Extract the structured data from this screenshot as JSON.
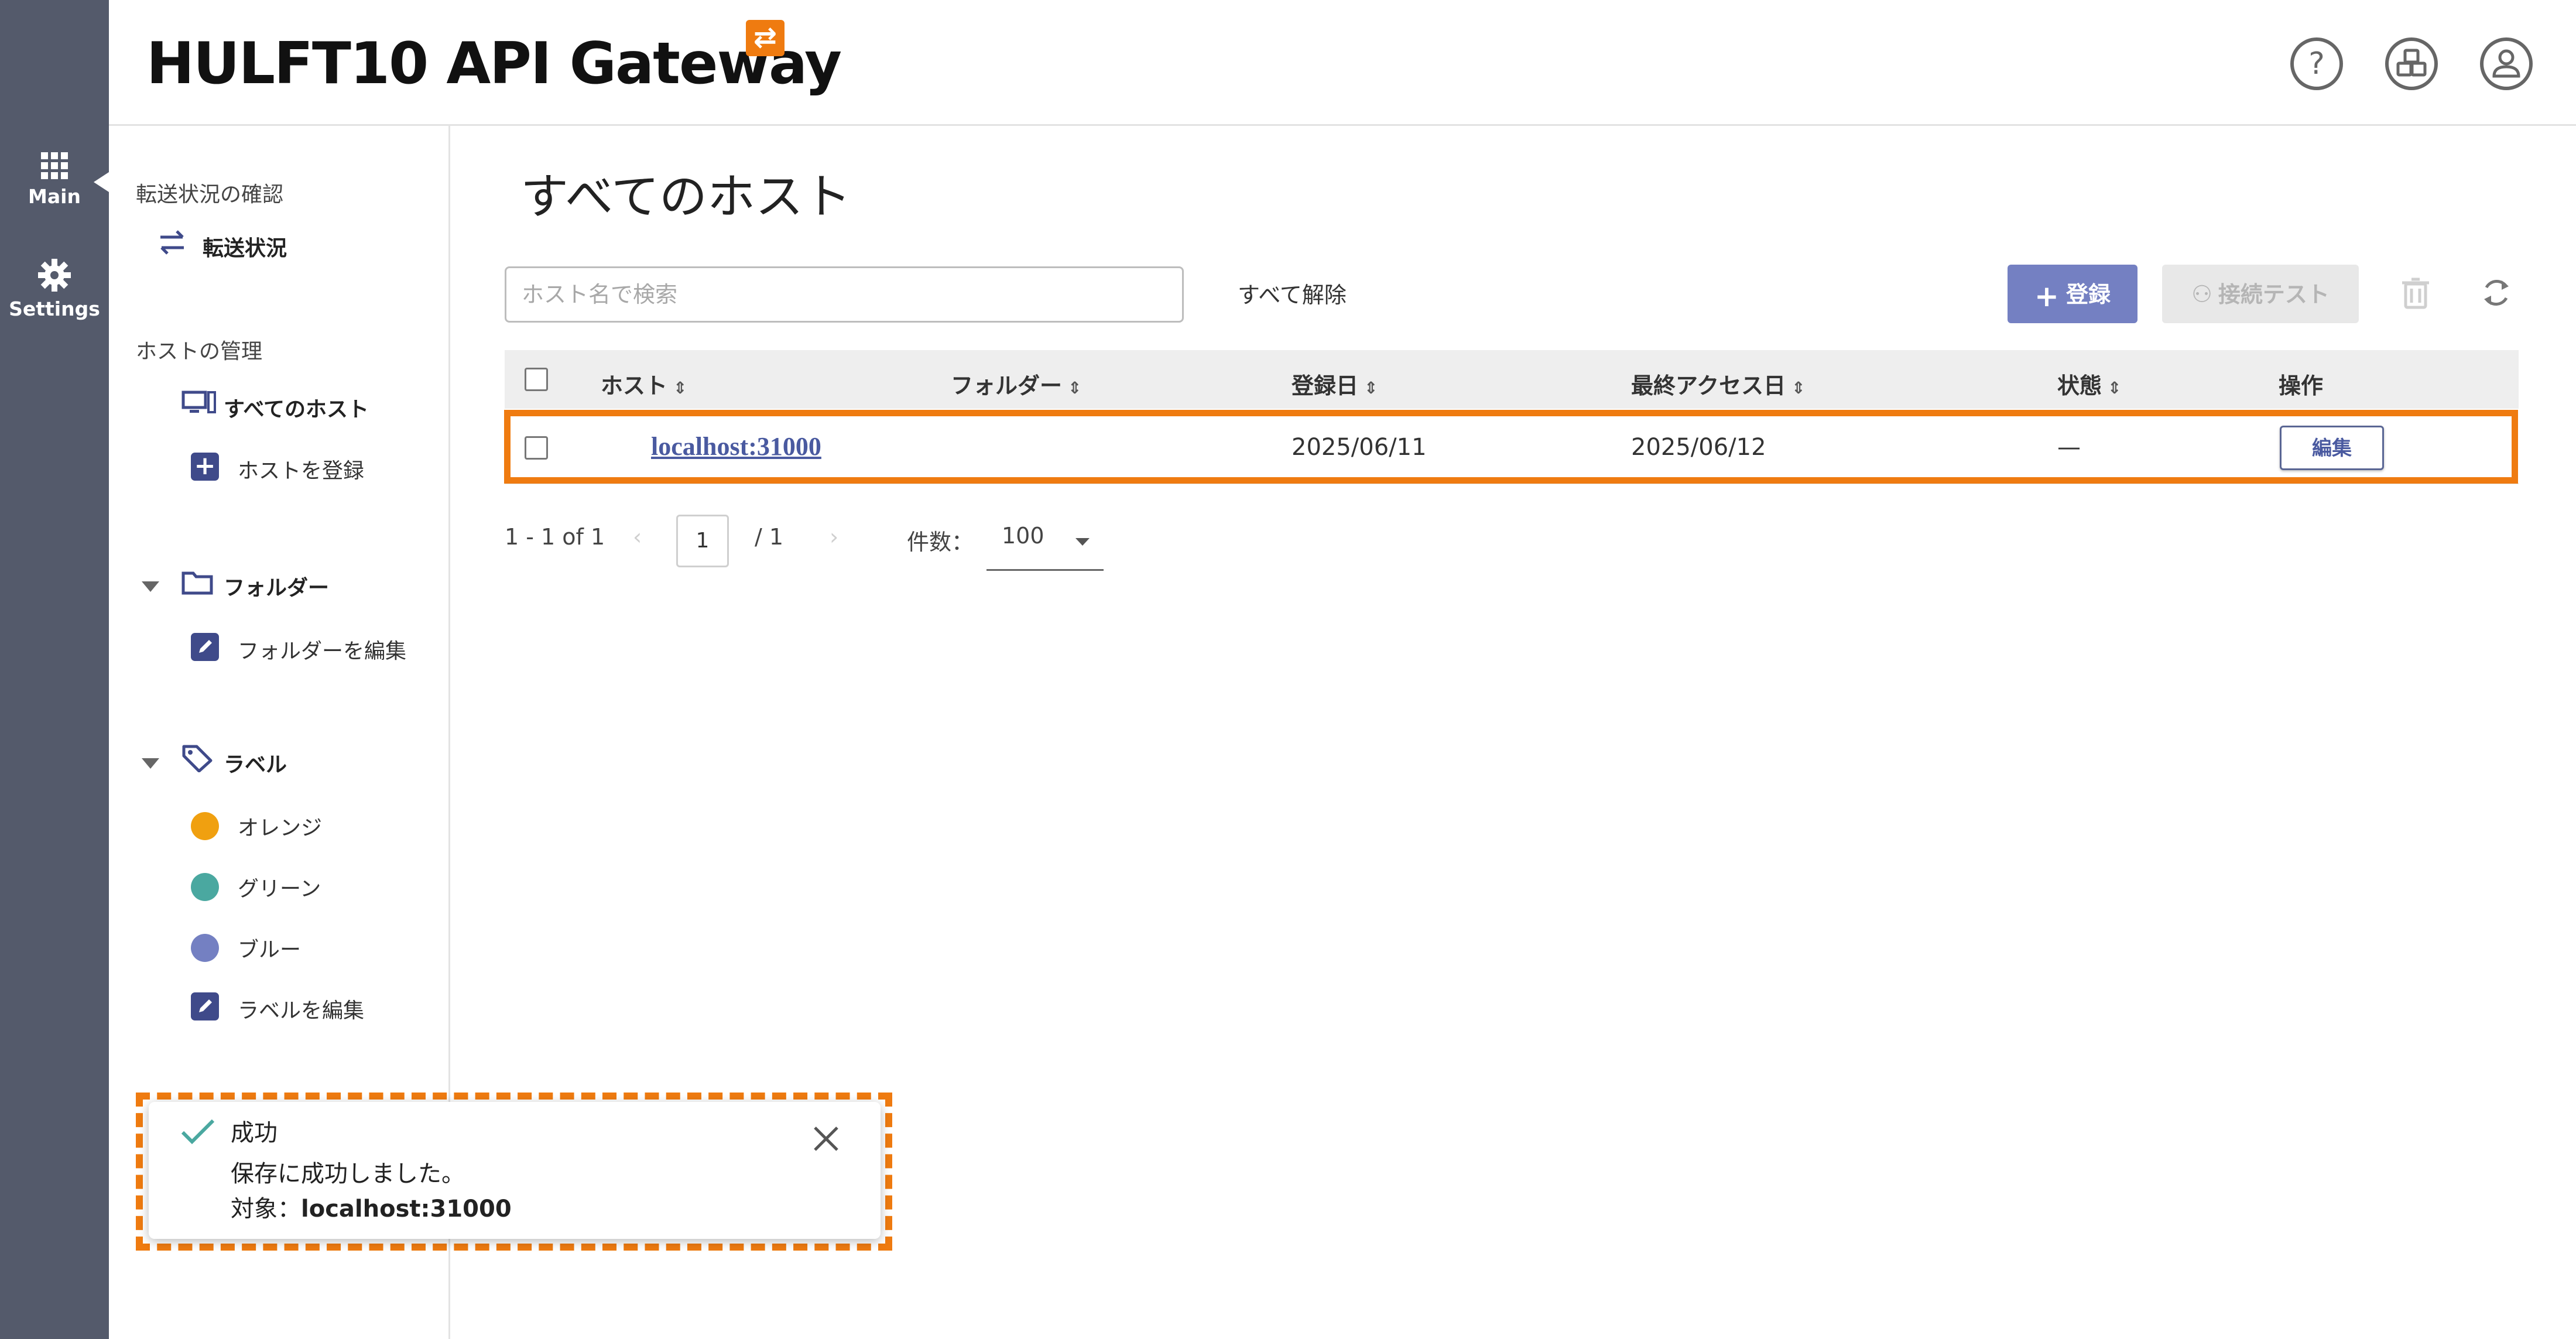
{
  "app": {
    "logo_text": "HULFT10 API Gateway",
    "logo_badge_glyph": "⇄",
    "accent_color": "#ef7b10",
    "rail_color": "#545a6b"
  },
  "rail": {
    "main_label": "Main",
    "settings_label": "Settings"
  },
  "header": {
    "icons": [
      "help-icon",
      "modules-icon",
      "account-icon"
    ]
  },
  "sidebar": {
    "transfer_section": "転送状況の確認",
    "transfer_item": "転送状況",
    "host_section": "ホストの管理",
    "all_hosts": "すべてのホスト",
    "register_host": "ホストを登録",
    "folder_section": "フォルダー",
    "edit_folder": "フォルダーを編集",
    "label_section": "ラベル",
    "labels": [
      {
        "name": "オレンジ",
        "color": "#f0a010"
      },
      {
        "name": "グリーン",
        "color": "#4aa8a0"
      },
      {
        "name": "ブルー",
        "color": "#7480c2"
      }
    ],
    "edit_label": "ラベルを編集"
  },
  "main": {
    "title": "すべてのホスト",
    "search_placeholder": "ホスト名で検索",
    "clear_all": "すべて解除",
    "register_button": "登録",
    "connection_test_button": "接続テスト",
    "columns": {
      "host": "ホスト",
      "folder": "フォルダー",
      "registered": "登録日",
      "last_access": "最終アクセス日",
      "status": "状態",
      "actions": "操作"
    },
    "rows": [
      {
        "host": "localhost:31000",
        "folder": "",
        "registered": "2025/06/11",
        "last_access": "2025/06/12",
        "status": "—",
        "action": "編集"
      }
    ],
    "pager": {
      "range": "1 - 1 of 1",
      "page": "1",
      "total": "/ 1",
      "per_page_label": "件数：",
      "per_page": "100"
    }
  },
  "toast": {
    "title": "成功",
    "message": "保存に成功しました。",
    "target_label": "対象：",
    "target_value": "localhost:31000"
  }
}
